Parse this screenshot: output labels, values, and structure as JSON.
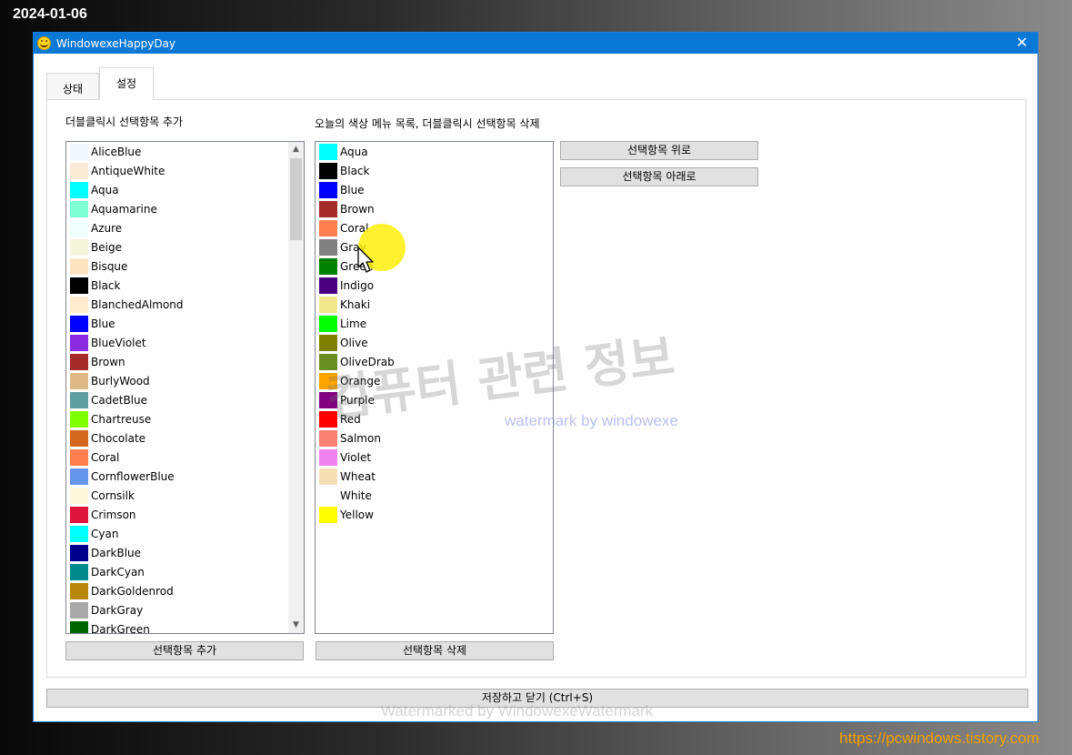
{
  "overlay": {
    "date": "2024-01-06",
    "url": "https://pcwindows.tistory.com"
  },
  "window": {
    "title": "WindowexeHappyDay",
    "app_icon": "smiley-icon",
    "close_icon": "close-icon",
    "close_glyph": "✕"
  },
  "tabs": [
    {
      "label": "상태",
      "active": false
    },
    {
      "label": "설정",
      "active": true
    }
  ],
  "left_panel": {
    "label": "더블클릭시 선택항목 추가",
    "items": [
      {
        "name": "AliceBlue",
        "color": "#f0f8ff"
      },
      {
        "name": "AntiqueWhite",
        "color": "#faebd7"
      },
      {
        "name": "Aqua",
        "color": "#00ffff"
      },
      {
        "name": "Aquamarine",
        "color": "#7fffd4"
      },
      {
        "name": "Azure",
        "color": "#f0ffff"
      },
      {
        "name": "Beige",
        "color": "#f5f5dc"
      },
      {
        "name": "Bisque",
        "color": "#ffe4c4"
      },
      {
        "name": "Black",
        "color": "#000000"
      },
      {
        "name": "BlanchedAlmond",
        "color": "#ffebcd"
      },
      {
        "name": "Blue",
        "color": "#0000ff"
      },
      {
        "name": "BlueViolet",
        "color": "#8a2be2"
      },
      {
        "name": "Brown",
        "color": "#a52a2a"
      },
      {
        "name": "BurlyWood",
        "color": "#deb887"
      },
      {
        "name": "CadetBlue",
        "color": "#5f9ea0"
      },
      {
        "name": "Chartreuse",
        "color": "#7fff00"
      },
      {
        "name": "Chocolate",
        "color": "#d2691e"
      },
      {
        "name": "Coral",
        "color": "#ff7f50"
      },
      {
        "name": "CornflowerBlue",
        "color": "#6495ed"
      },
      {
        "name": "Cornsilk",
        "color": "#fff8dc"
      },
      {
        "name": "Crimson",
        "color": "#dc143c"
      },
      {
        "name": "Cyan",
        "color": "#00ffff"
      },
      {
        "name": "DarkBlue",
        "color": "#00008b"
      },
      {
        "name": "DarkCyan",
        "color": "#008b8b"
      },
      {
        "name": "DarkGoldenrod",
        "color": "#b8860b"
      },
      {
        "name": "DarkGray",
        "color": "#a9a9a9"
      },
      {
        "name": "DarkGreen",
        "color": "#006400"
      }
    ],
    "button": "선택항목 추가"
  },
  "middle_panel": {
    "label": "오늘의 색상 메뉴 목록, 더블클릭시 선택항목 삭제",
    "items": [
      {
        "name": "Aqua",
        "color": "#00ffff"
      },
      {
        "name": "Black",
        "color": "#000000"
      },
      {
        "name": "Blue",
        "color": "#0000ff"
      },
      {
        "name": "Brown",
        "color": "#a52a2a"
      },
      {
        "name": "Coral",
        "color": "#ff7f50"
      },
      {
        "name": "Gray",
        "color": "#808080"
      },
      {
        "name": "Green",
        "color": "#008000"
      },
      {
        "name": "Indigo",
        "color": "#4b0082"
      },
      {
        "name": "Khaki",
        "color": "#f0e68c"
      },
      {
        "name": "Lime",
        "color": "#00ff00"
      },
      {
        "name": "Olive",
        "color": "#808000"
      },
      {
        "name": "OliveDrab",
        "color": "#6b8e23"
      },
      {
        "name": "Orange",
        "color": "#ffa500"
      },
      {
        "name": "Purple",
        "color": "#800080"
      },
      {
        "name": "Red",
        "color": "#ff0000"
      },
      {
        "name": "Salmon",
        "color": "#fa8072"
      },
      {
        "name": "Violet",
        "color": "#ee82ee"
      },
      {
        "name": "Wheat",
        "color": "#f5deb3"
      },
      {
        "name": "White",
        "color": "#ffffff"
      },
      {
        "name": "Yellow",
        "color": "#ffff00"
      }
    ],
    "button": "선택항목 삭제"
  },
  "right_buttons": {
    "move_up": "선택항목 위로",
    "move_down": "선택항목 아래로"
  },
  "footer": {
    "save_close": "저장하고 닫기 (Ctrl+S)"
  },
  "watermarks": {
    "korean": "컴퓨터 관련 정보",
    "english": "watermark by windowexe",
    "bottom": "Watermarked by WindowexeWatermark"
  }
}
